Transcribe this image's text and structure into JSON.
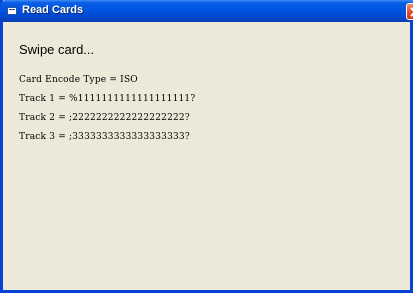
{
  "window": {
    "title": "Read Cards"
  },
  "status": "Swipe card...",
  "lines": [
    "Card Encode Type = ISO",
    "Track 1 = %1111111111111111111?",
    "Track 2 = ;2222222222222222222?",
    "Track 3 = ;3333333333333333333?"
  ],
  "colors": {
    "titlebar": "#0055e0",
    "window_bg": "#ece9d8",
    "close_button": "#e2542d"
  }
}
